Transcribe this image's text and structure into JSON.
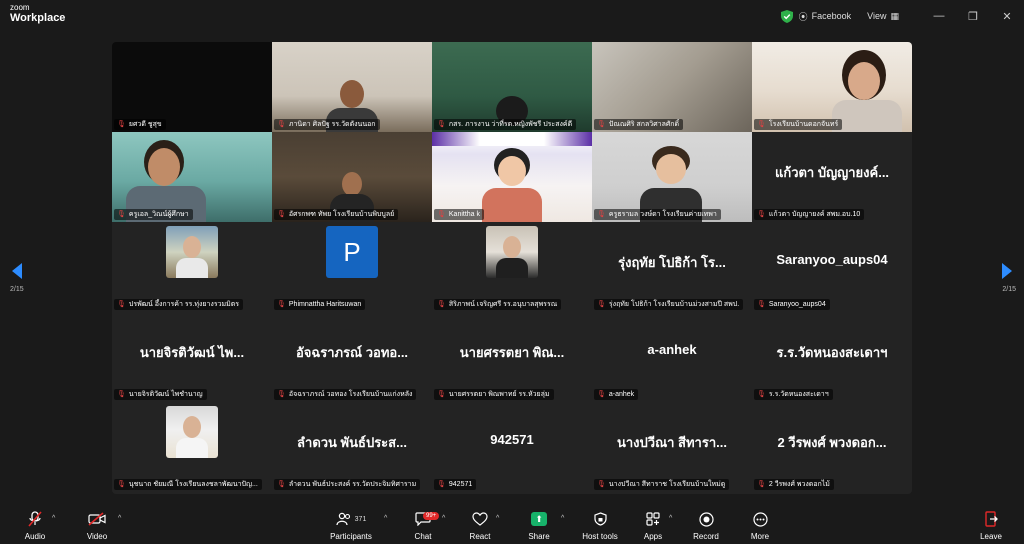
{
  "app": {
    "brand_small": "zoom",
    "brand_large": "Workplace"
  },
  "topbar": {
    "stream_label": "Facebook",
    "view_label": "View",
    "minimize": "—",
    "restore": "❐",
    "close": "✕"
  },
  "pager": {
    "left": "2/15",
    "right": "2/15"
  },
  "tiles": [
    {
      "name": "ยศวดี ชูสุข",
      "big": ""
    },
    {
      "name": "ภานิดา ศิลปัฐ รร.วัดตังนนอก",
      "big": ""
    },
    {
      "name": "กสร. ภารงาน ว่าที่รต.หญิงพัชรี ประสงค์ดี",
      "big": ""
    },
    {
      "name": "ปัณณศิริ สกลวิศาลศักดิ์",
      "big": ""
    },
    {
      "name": "โรงเรียนบ้านดอกจันทร์",
      "big": ""
    },
    {
      "name": "ครูเอล_วิณน์ผู้ศึกษา",
      "big": ""
    },
    {
      "name": "อัศรกพฑ ทัพย โรงเรียนบ้านพิบบูลย์",
      "big": ""
    },
    {
      "name": "Kanittha k",
      "big": ""
    },
    {
      "name": "ครูธรามล วงษ์ดา โรงเรียนค่ายเทพา",
      "big": ""
    },
    {
      "name": "แก้วตา บัญญายงค์ สพม.อบ.10",
      "big": "แก้วตา บัญญายงค์..."
    },
    {
      "name": "ปรพัฒน์ อึ้งการค้า รร.ทุ่งยางรวมมิตร",
      "big": ""
    },
    {
      "name": "Phimnattha Haritsuwan",
      "big": "",
      "avatar": "P"
    },
    {
      "name": "สิริภาพน์ เจริญศรี รร.อนุบาลสุพรรณ",
      "big": ""
    },
    {
      "name": "รุ่งฤทัย โปธิก้า โรงเรียนบ้านม่วงสามปี สพป.",
      "big": "รุ่งฤทัย โปธิก้า โร..."
    },
    {
      "name": "Saranyoo_aups04",
      "big": "Saranyoo_aups04"
    },
    {
      "name": "นายจิรติวัฒน์ ไพชำนาญ",
      "big": "นายจิรติวัฒน์ ไพ..."
    },
    {
      "name": "อัจฉราภรณ์ วอทอง โรงเรียนบ้านแก่งหลัง",
      "big": "อัจฉราภรณ์ วอทอ..."
    },
    {
      "name": "นายศรรตยา พิณพาทย์ รร.หัวยลุ่ม",
      "big": "นายศรรตยา พิณ..."
    },
    {
      "name": "a-anhek",
      "big": "a-anhek"
    },
    {
      "name": "ร.ร.วัดหนองสะเดาฯ",
      "big": "ร.ร.วัดหนองสะเดาฯ"
    },
    {
      "name": "นุชนาถ ชัยมณี โรงเรียนลงชลาพัฒนาปัญ...",
      "big": ""
    },
    {
      "name": "ลำดวน พันธ์ประสงค์ รร.วัดประจิมทิศาราม",
      "big": "ลำดวน พันธ์ประส..."
    },
    {
      "name": "942571",
      "big": "942571"
    },
    {
      "name": "นางปวีณา สีทาราช โรงเรียนบ้านใหม่ดู",
      "big": "นางปวีณา สีทารา..."
    },
    {
      "name": "2 วีรพงศ์ พวงดอกไม้",
      "big": "2 วีรพงศ์ พวงดอก..."
    }
  ],
  "toolbar": {
    "audio": "Audio",
    "video": "Video",
    "participants": "Participants",
    "participants_count": "371",
    "chat": "Chat",
    "chat_badge": "99+",
    "react": "React",
    "share": "Share",
    "host_tools": "Host tools",
    "apps": "Apps",
    "record": "Record",
    "more": "More",
    "leave": "Leave"
  },
  "colors": {
    "mic_muted": "#e04242",
    "share_green": "#17b26a",
    "leave_red": "#e02828",
    "nav_blue": "#2d8cff"
  }
}
